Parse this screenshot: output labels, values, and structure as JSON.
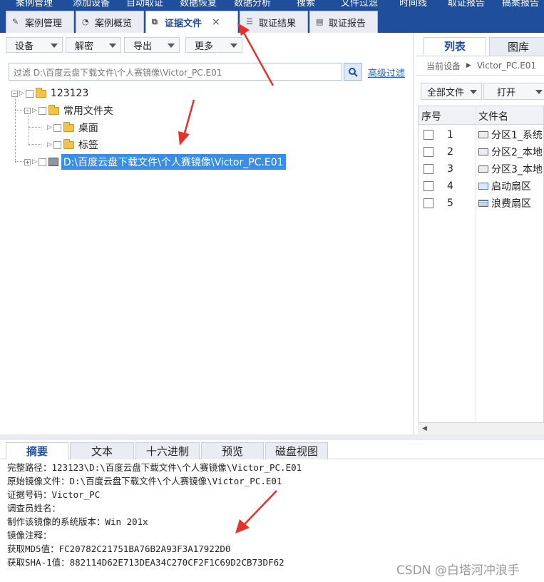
{
  "top_menu": [
    "案例管理",
    "添加设备",
    "自动取证",
    "数据恢复",
    "数据分析",
    "搜索",
    "文件过滤",
    "时间线",
    "取证报告",
    "搞案报告"
  ],
  "tabs": [
    {
      "label": "案例管理"
    },
    {
      "label": "案例概览"
    },
    {
      "label": "证据文件",
      "active": true,
      "close": "×"
    },
    {
      "label": "取证结果"
    },
    {
      "label": "取证报告"
    }
  ],
  "toolbar": [
    "设备",
    "解密",
    "导出",
    "更多"
  ],
  "filter": {
    "text": "过滤 D:\\百度云盘下载文件\\个人赛镜像\\Victor_PC.E01",
    "advanced": "高级过滤"
  },
  "tree": {
    "root": "123123",
    "common": "常用文件夹",
    "desktop": "桌面",
    "tags": "标签",
    "image": "D:\\百度云盘下载文件\\个人赛镜像\\Victor_PC.E01"
  },
  "right": {
    "tabs": [
      "列表",
      "图库"
    ],
    "crumb_device": "当前设备",
    "crumb_item": "Victor_PC.E01",
    "buttons": [
      "全部文件",
      "打开"
    ],
    "headers": [
      "序号",
      "文件名"
    ],
    "rows": [
      {
        "num": "1",
        "name": "分区1_系统"
      },
      {
        "num": "2",
        "name": "分区2_本地"
      },
      {
        "num": "3",
        "name": "分区3_本地"
      },
      {
        "num": "4",
        "name": "启动扇区"
      },
      {
        "num": "5",
        "name": "浪费扇区"
      }
    ]
  },
  "bottom_tabs": [
    "摘要",
    "文本",
    "十六进制",
    "预览",
    "磁盘视图"
  ],
  "summary": [
    "完整路径：123123\\D:\\百度云盘下载文件\\个人赛镜像\\Victor_PC.E01",
    "原始镜像文件：D:\\百度云盘下载文件\\个人赛镜像\\Victor_PC.E01",
    "证据号码：Victor_PC",
    "调查员姓名：",
    "制作该镜像的系统版本：Win 201x",
    "镜像注释：",
    "获取MD5值：FC20782C21751BA76B2A93F3A17922D0",
    "获取SHA-1值：882114D62E713DEA34C270CF2F1C69D2CB73DF62"
  ],
  "watermark": "CSDN @白塔河冲浪手",
  "colors": {
    "header": "#1f4e9c",
    "selection": "#3a8ee6",
    "annotation": "#e8302a"
  }
}
